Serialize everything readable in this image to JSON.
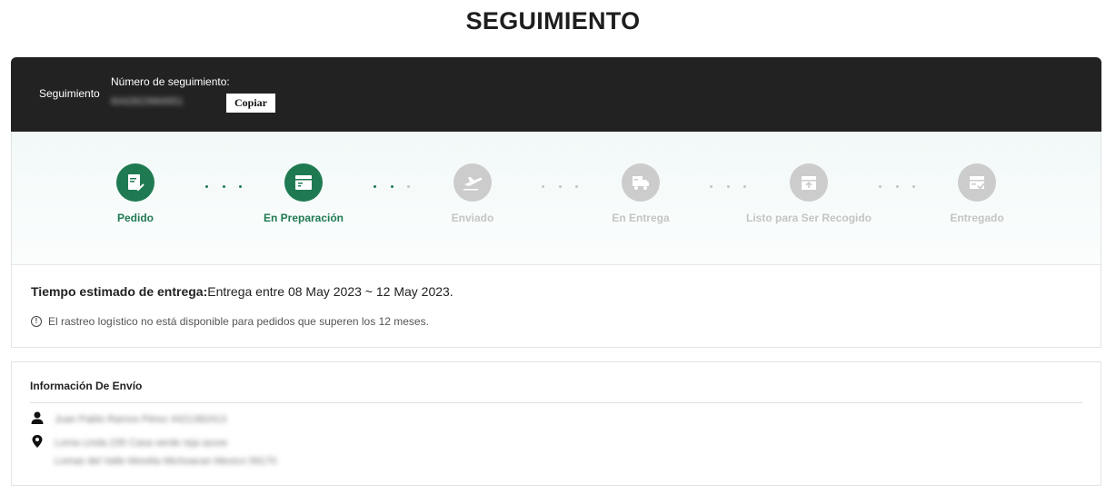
{
  "page": {
    "title": "SEGUIMIENTO"
  },
  "header": {
    "label": "Seguimiento",
    "tracking_number_label": "Número de seguimiento:",
    "tracking_number": "6042823964951",
    "copy_button": "Copiar"
  },
  "steps": [
    {
      "label": "Pedido",
      "state": "completed",
      "icon": "order-icon"
    },
    {
      "label": "En Preparación",
      "state": "completed",
      "icon": "preparing-icon"
    },
    {
      "label": "Enviado",
      "state": "pending",
      "icon": "plane-icon"
    },
    {
      "label": "En Entrega",
      "state": "pending",
      "icon": "truck-icon"
    },
    {
      "label": "Listo para Ser Recogido",
      "state": "pending",
      "icon": "pickup-box-icon"
    },
    {
      "label": "Entregado",
      "state": "pending",
      "icon": "delivered-box-icon"
    }
  ],
  "delivery": {
    "eta_label": "Tiempo estimado de entrega:",
    "eta_value": "Entrega entre 08 May 2023 ~ 12 May 2023.",
    "notice": "El rastreo logístico no está disponible para pedidos que superen los 12 meses."
  },
  "shipping": {
    "title": "Información De Envío",
    "recipient": "Juan Pablo Ramos Pérez 4421382413",
    "address_line1": "Loma Linda 235 Casa verde reja azure",
    "address_line2": "Lomas del Valle Morelia Michoacan Mexico 58170"
  },
  "colors": {
    "accent": "#1f7a52",
    "inactive": "#cccccc",
    "header_bg": "#222222"
  }
}
